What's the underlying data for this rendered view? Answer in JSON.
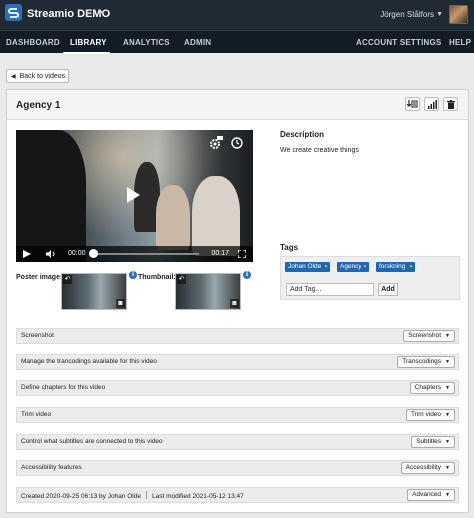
{
  "app": {
    "title": "Streamio DEMO",
    "user_name": "Jörgen Stålfors"
  },
  "nav": {
    "left": [
      "DASHBOARD",
      "LIBRARY",
      "ANALYTICS",
      "ADMIN"
    ],
    "right": [
      "ACCOUNT SETTINGS",
      "HELP"
    ],
    "active": "LIBRARY"
  },
  "back_label": "Back to videos",
  "page_title": "Agency 1",
  "video": {
    "current_time": "00:00",
    "duration": "00:17"
  },
  "poster_label": "Poster image:",
  "thumbnail_label": "Thumbnail:",
  "description": {
    "title": "Description",
    "text": "We create creative things"
  },
  "tags": {
    "title": "Tags",
    "items": [
      "Johan Olde",
      "Agency",
      "forskning"
    ],
    "input_placeholder": "Add Tag...",
    "add_label": "Add"
  },
  "rows": [
    {
      "label": "Screenshot",
      "button": "Screenshot"
    },
    {
      "label": "Manage the trancodings available for this video",
      "button": "Transcodings"
    },
    {
      "label": "Define chapters for this video",
      "button": "Chapters"
    },
    {
      "label": "Trim video",
      "button": "Trim video"
    },
    {
      "label": "Control what subtitles are connected to this video",
      "button": "Subtitles"
    },
    {
      "label": "Accessibility features",
      "button": "Accessibility"
    }
  ],
  "footer": {
    "created": "Created 2020-09-25 06:13 by Johan Olde",
    "modified": "Last modified 2021-05-12 13:47",
    "button": "Advanced"
  },
  "icons": [
    "streamio-logo-icon",
    "download-icon",
    "stats-icon",
    "trash-icon",
    "play-icon",
    "volume-icon",
    "fullscreen-icon",
    "gear-icon",
    "clock-icon",
    "revert-icon",
    "camera-icon",
    "info-icon"
  ],
  "colors": {
    "topbar": "#1f2a35",
    "navbar": "#121c26",
    "accent": "#2067b0"
  }
}
